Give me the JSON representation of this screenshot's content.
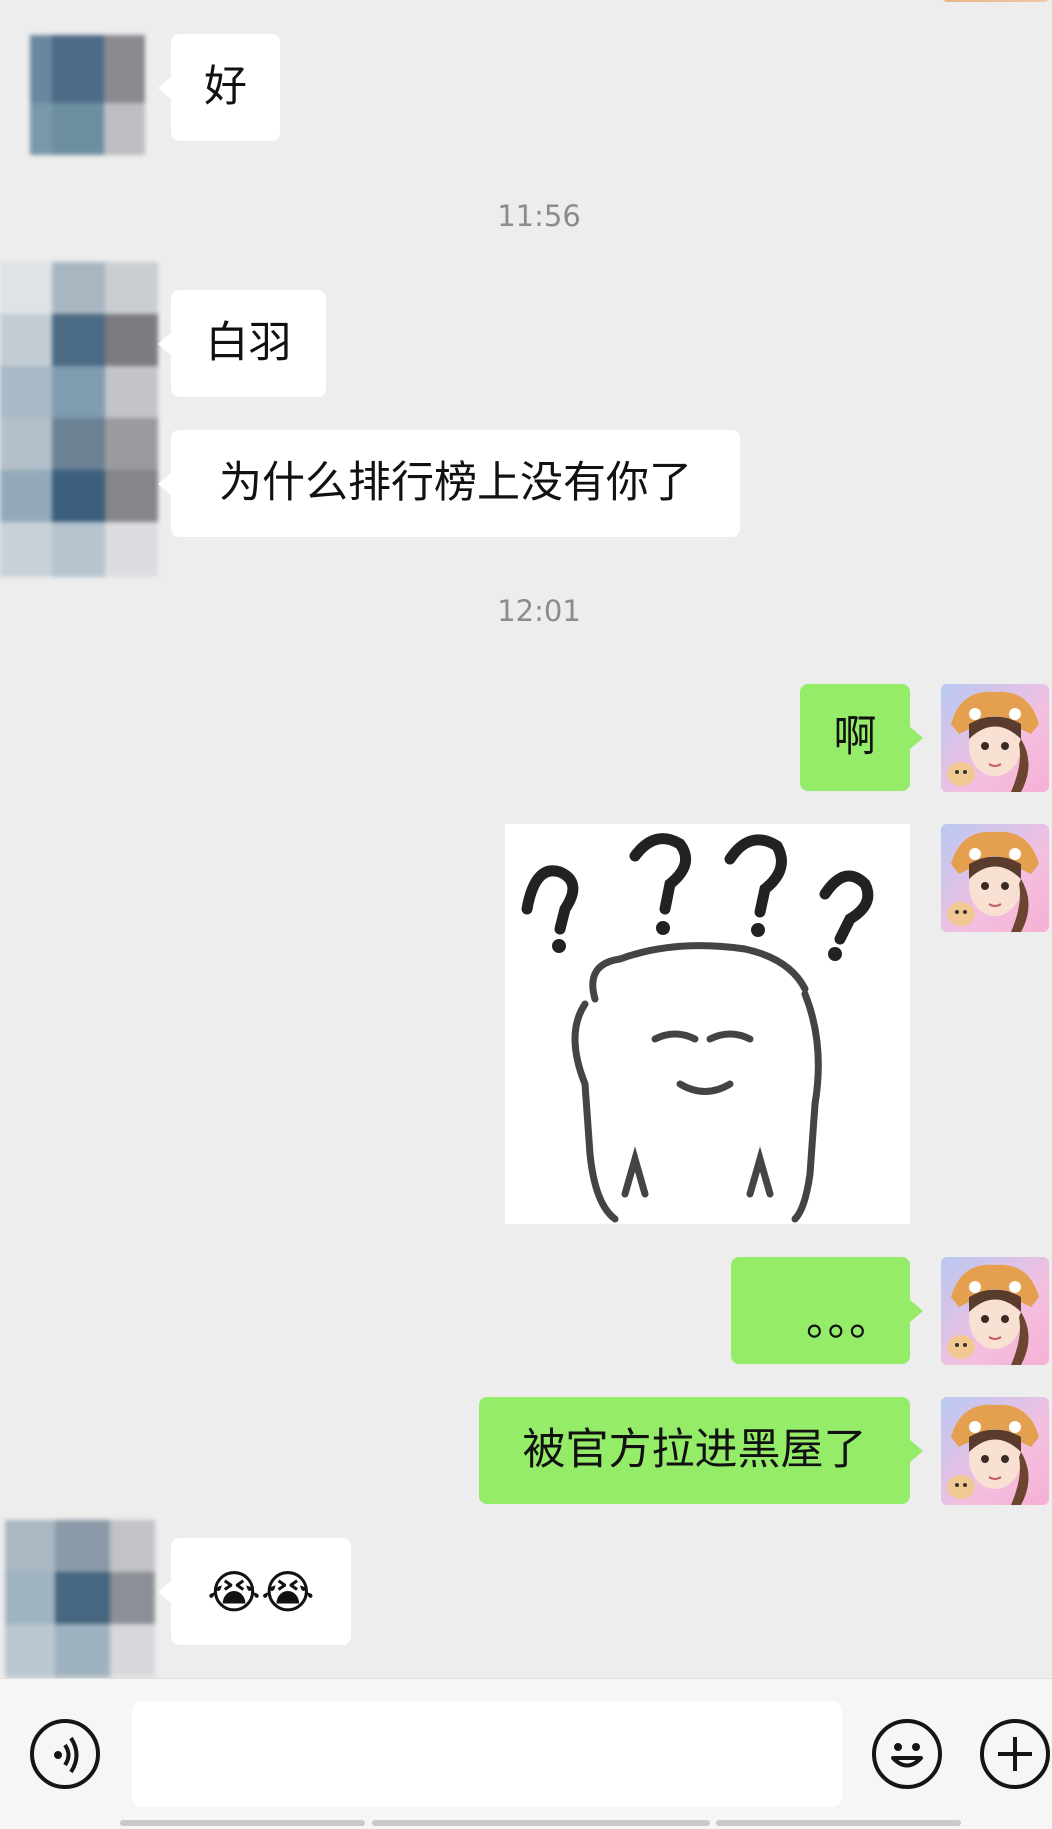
{
  "chat": {
    "timestamps": [
      "11:56",
      "12:01"
    ],
    "messages": [
      {
        "side": "received",
        "text": "好"
      },
      {
        "side": "received",
        "text": "白羽"
      },
      {
        "side": "received",
        "text": "为什么排行榜上没有你了"
      },
      {
        "side": "sent",
        "text": "啊"
      },
      {
        "side": "sent",
        "type": "sticker",
        "sticker": "question-marks-bear-sticker"
      },
      {
        "side": "sent",
        "text": "。。。"
      },
      {
        "side": "sent",
        "text": "被官方拉进黑屋了"
      },
      {
        "side": "received",
        "text": "😭😭"
      }
    ]
  },
  "input_bar": {
    "voice_icon": "voice-icon",
    "emoji_icon": "emoji-icon",
    "plus_icon": "plus-icon",
    "input_value": ""
  },
  "colors": {
    "background": "#ededed",
    "sent_bubble": "#95ec69",
    "received_bubble": "#ffffff"
  }
}
